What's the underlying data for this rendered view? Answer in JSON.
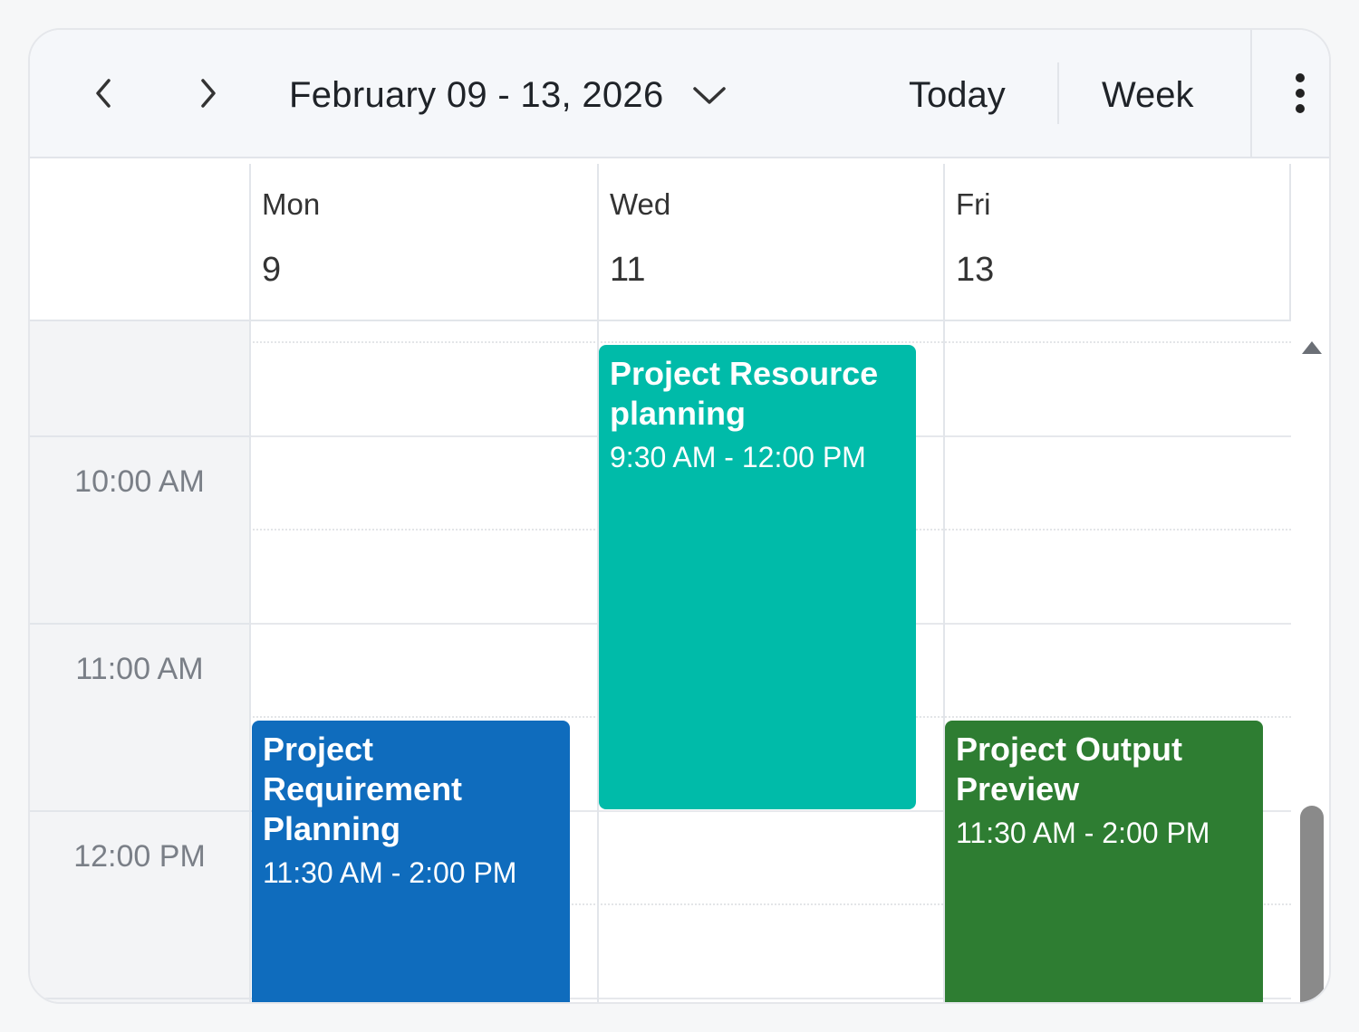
{
  "toolbar": {
    "prev_icon": "chevron-left-icon",
    "next_icon": "chevron-right-icon",
    "date_range": "February 09 - 13, 2026",
    "date_dropdown_icon": "chevron-down-icon",
    "today_label": "Today",
    "view_label": "Week",
    "more_icon": "more-vertical-icon"
  },
  "days": [
    {
      "name": "Mon",
      "number": "9"
    },
    {
      "name": "Wed",
      "number": "11"
    },
    {
      "name": "Fri",
      "number": "13"
    }
  ],
  "time_labels": [
    "10:00 AM",
    "11:00 AM",
    "12:00 PM"
  ],
  "events": [
    {
      "title": "Project Resource planning",
      "time": "9:30 AM - 12:00 PM",
      "day": "Wed",
      "color": "#00bba9"
    },
    {
      "title": "Project Requirement Planning",
      "time": "11:30 AM - 2:00 PM",
      "day": "Mon",
      "color": "#0f6cbd"
    },
    {
      "title": "Project Output Preview",
      "time": "11:30 AM - 2:00 PM",
      "day": "Fri",
      "color": "#2e7d32"
    }
  ],
  "colors": {
    "toolbar_bg": "#f5f7fa",
    "time_column_bg": "#f3f4f6",
    "scroll_thumb": "#8a8a8a"
  }
}
